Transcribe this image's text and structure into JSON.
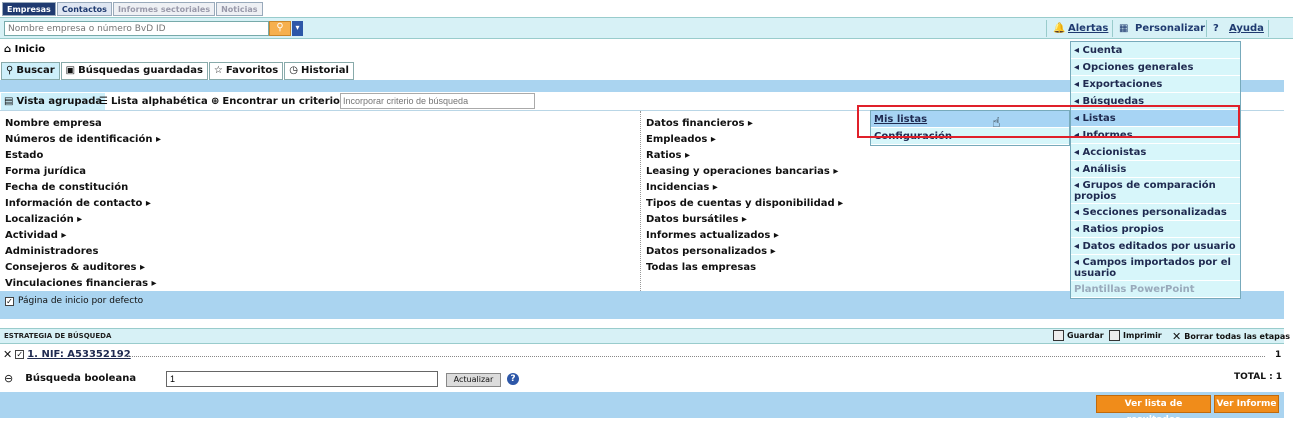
{
  "top_tabs": [
    {
      "label": "Empresas",
      "state": "active"
    },
    {
      "label": "Contactos",
      "state": "normal"
    },
    {
      "label": "Informes sectoriales",
      "state": "disabled"
    },
    {
      "label": "Noticias",
      "state": "disabled"
    }
  ],
  "header": {
    "search_placeholder": "Nombre empresa o número BvD ID",
    "alertas": "Alertas",
    "personalizar": "Personalizar",
    "ayuda": "Ayuda"
  },
  "breadcrumb": "Inicio",
  "main_tabs": [
    {
      "label": "Buscar",
      "icon": "search-icon"
    },
    {
      "label": "Búsquedas guardadas",
      "icon": "save-icon"
    },
    {
      "label": "Favoritos",
      "icon": "star-icon"
    },
    {
      "label": "Historial",
      "icon": "history-icon"
    }
  ],
  "view_tabs": [
    {
      "label": "Vista agrupada"
    },
    {
      "label": "Lista alphabética"
    },
    {
      "label": "Encontrar un criterio"
    }
  ],
  "criterion_placeholder": "Incorporar criterio de búsqueda",
  "criteria_left": [
    "Nombre empresa",
    "Números de identificación ▸",
    "Estado",
    "Forma jurídica",
    "Fecha de constitución",
    "Información de contacto ▸",
    "Localización ▸",
    "Actividad ▸",
    "Administradores",
    "Consejeros & auditores ▸",
    "Vinculaciones financieras ▸"
  ],
  "criteria_right": [
    "Datos financieros ▸",
    "Empleados ▸",
    "Ratios ▸",
    "Leasing y operaciones bancarias ▸",
    "Incidencias ▸",
    "Tipos de cuentas y disponibilidad ▸",
    "Datos bursátiles ▸",
    "Informes actualizados ▸",
    "Datos personalizados ▸",
    "Todas las empresas"
  ],
  "default_home_label": "Página de inicio por defecto",
  "strategy": {
    "title": "ESTRATEGIA DE BÚSQUEDA",
    "guardar": "Guardar",
    "imprimir": "Imprimir",
    "borrar": "Borrar todas las etapas",
    "step_label": "1. NIF: A53352192",
    "step_count": "1",
    "boolean_label": "Búsqueda booleana",
    "boolean_value": "1",
    "update_button": "Actualizar",
    "total": "TOTAL : 1"
  },
  "footer": {
    "results_button": "Ver lista de resultados",
    "report_button": "Ver Informe"
  },
  "menu_items": [
    "◂ Cuenta",
    "◂ Opciones generales",
    "◂ Exportaciones",
    "◂ Búsquedas",
    "◂ Listas",
    "◂ Informes",
    "◂ Accionistas",
    "◂ Análisis",
    "◂ Grupos de comparación propios",
    "◂ Secciones personalizadas",
    "◂ Ratios propios",
    "◂ Datos editados por usuario",
    "◂ Campos importados por el usuario",
    "Plantillas PowerPoint"
  ],
  "submenu_items": [
    "Mis listas",
    "Configuración"
  ],
  "colors": {
    "accent": "#1f3a70",
    "panel": "#aad4f0",
    "orange": "#f08c1a",
    "highlight": "#e0202a"
  }
}
